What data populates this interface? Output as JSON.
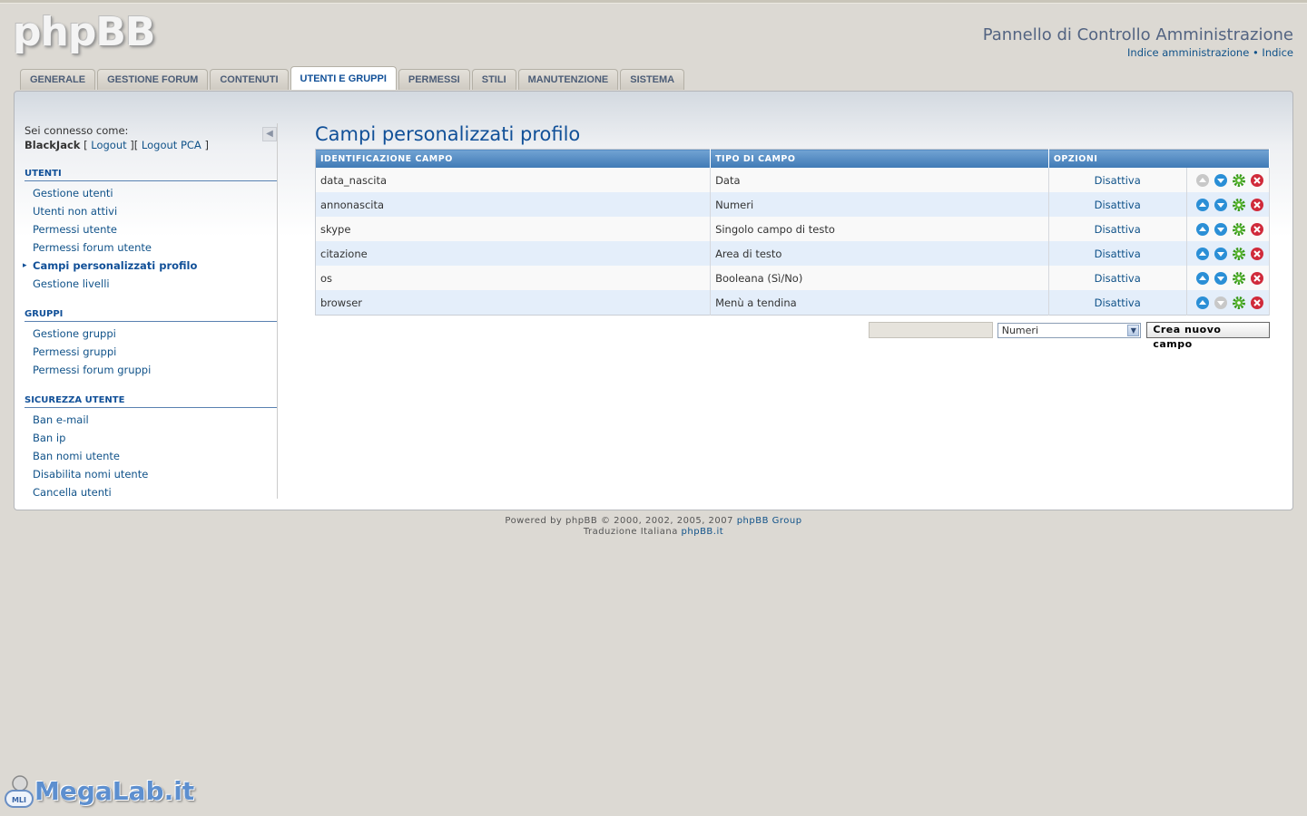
{
  "header": {
    "logo": "phpBB",
    "title": "Pannello di Controllo Amministrazione",
    "link_admin_index": "Indice amministrazione",
    "link_separator": "•",
    "link_index": "Indice"
  },
  "tabs": [
    {
      "label": "Generale",
      "active": false
    },
    {
      "label": "Gestione forum",
      "active": false
    },
    {
      "label": "Contenuti",
      "active": false
    },
    {
      "label": "Utenti e gruppi",
      "active": true
    },
    {
      "label": "Permessi",
      "active": false
    },
    {
      "label": "Stili",
      "active": false
    },
    {
      "label": "Manutenzione",
      "active": false
    },
    {
      "label": "Sistema",
      "active": false
    }
  ],
  "sidebar": {
    "logged_as": "Sei connesso come:",
    "username": "BlackJack",
    "logout": "Logout",
    "logout_acp": "Logout PCA",
    "sections": [
      {
        "title": "Utenti",
        "items": [
          {
            "label": "Gestione utenti"
          },
          {
            "label": "Utenti non attivi"
          },
          {
            "label": "Permessi utente"
          },
          {
            "label": "Permessi forum utente"
          },
          {
            "label": "Campi personalizzati profilo",
            "active": true
          },
          {
            "label": "Gestione livelli"
          }
        ]
      },
      {
        "title": "Gruppi",
        "items": [
          {
            "label": "Gestione gruppi"
          },
          {
            "label": "Permessi gruppi"
          },
          {
            "label": "Permessi forum gruppi"
          }
        ]
      },
      {
        "title": "Sicurezza utente",
        "items": [
          {
            "label": "Ban e-mail"
          },
          {
            "label": "Ban ip"
          },
          {
            "label": "Ban nomi utente"
          },
          {
            "label": "Disabilita nomi utente"
          },
          {
            "label": "Cancella utenti"
          }
        ]
      }
    ]
  },
  "main": {
    "title": "Campi personalizzati profilo",
    "columns": [
      "Identificazione campo",
      "Tipo di campo",
      "Opzioni"
    ],
    "rows": [
      {
        "name": "data_nascita",
        "type": "Data",
        "status": "Disattiva",
        "up_enabled": false,
        "down_enabled": true
      },
      {
        "name": "annonascita",
        "type": "Numeri",
        "status": "Disattiva",
        "up_enabled": true,
        "down_enabled": true
      },
      {
        "name": "skype",
        "type": "Singolo campo di testo",
        "status": "Disattiva",
        "up_enabled": true,
        "down_enabled": true
      },
      {
        "name": "citazione",
        "type": "Area di testo",
        "status": "Disattiva",
        "up_enabled": true,
        "down_enabled": true
      },
      {
        "name": "os",
        "type": "Booleana (Sì/No)",
        "status": "Disattiva",
        "up_enabled": true,
        "down_enabled": true
      },
      {
        "name": "browser",
        "type": "Menù a tendina",
        "status": "Disattiva",
        "up_enabled": true,
        "down_enabled": false
      }
    ],
    "new_field": {
      "input_value": "",
      "select_value": "Numeri",
      "button_label": "Crea nuovo campo"
    }
  },
  "footer": {
    "powered_text": "Powered by phpBB © 2000, 2002, 2005, 2007",
    "powered_link": "phpBB Group",
    "translation_text": "Traduzione Italiana",
    "translation_link": "phpBB.it"
  },
  "watermark": {
    "text": "MegaLab.it",
    "badge": "MLI"
  },
  "colors": {
    "accent": "#115098",
    "link": "#105289",
    "header_grad": "#3f7ab5",
    "row_alt": "#e4eefa"
  }
}
